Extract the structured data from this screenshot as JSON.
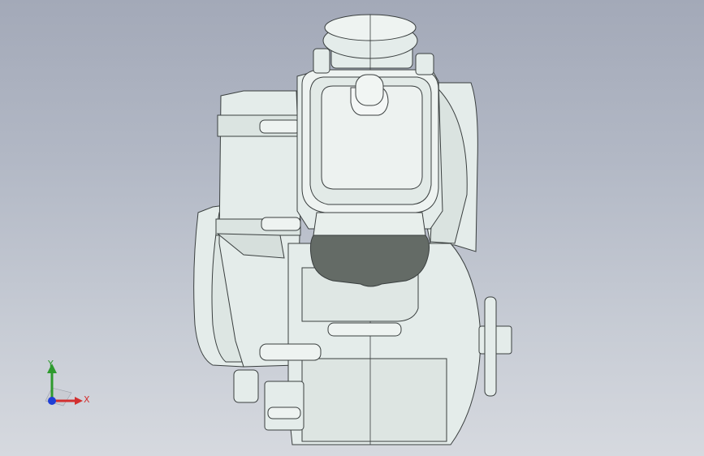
{
  "viewport": {
    "background_top": "#a3a9b8",
    "background_bottom": "#d6d9df"
  },
  "model": {
    "body_color": "#e4ecea",
    "edge_color": "#3a3f3f",
    "gasket_color": "#646b66"
  },
  "triad": {
    "x_label": "X",
    "y_label": "Y",
    "x_color": "#d23030",
    "y_color": "#2e9a2e",
    "z_color": "#1f3fd6"
  }
}
